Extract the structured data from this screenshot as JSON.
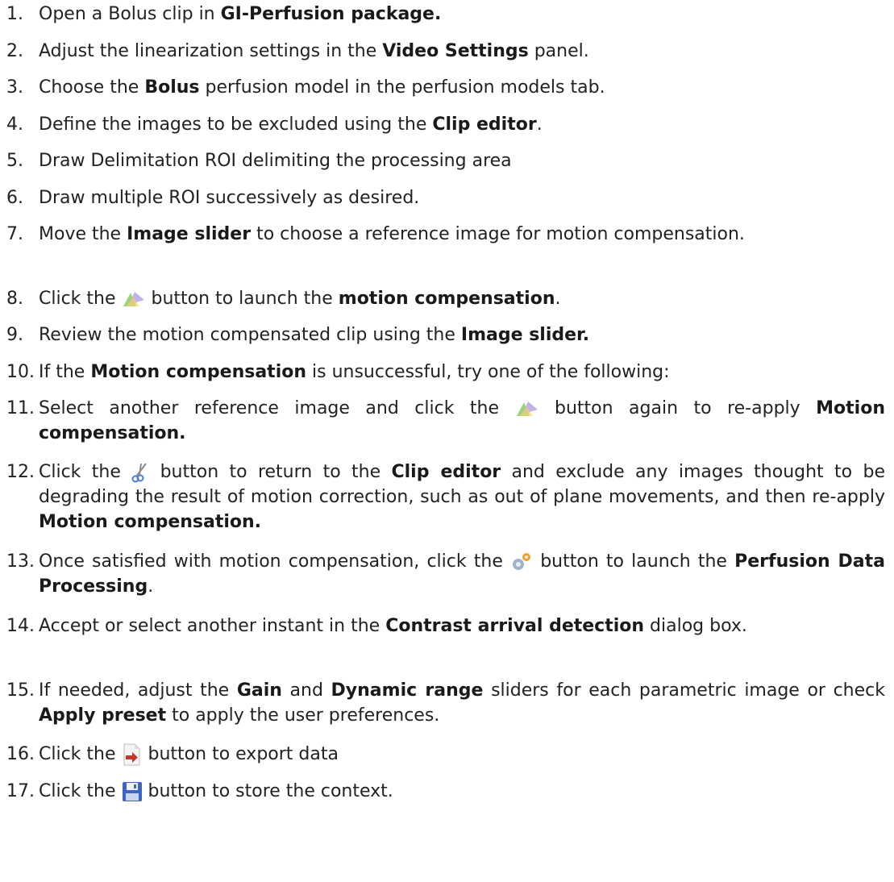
{
  "steps": [
    {
      "num": "1.",
      "parts": [
        {
          "t": "Open a Bolus clip in "
        },
        {
          "b": "GI-Perfusion package."
        }
      ]
    },
    {
      "num": "2.",
      "parts": [
        {
          "t": "Adjust the linearization settings in the "
        },
        {
          "b": "Video Settings"
        },
        {
          "t": " panel."
        }
      ]
    },
    {
      "num": "3.",
      "parts": [
        {
          "t": "Choose the "
        },
        {
          "b": "Bolus"
        },
        {
          "t": " perfusion model in the perfusion models tab."
        }
      ]
    },
    {
      "num": "4.",
      "parts": [
        {
          "t": "Define the images to be excluded using the "
        },
        {
          "b": "Clip editor"
        },
        {
          "t": "."
        }
      ]
    },
    {
      "num": "5.",
      "parts": [
        {
          "t": "Draw Delimitation ROI delimiting the processing area"
        }
      ]
    },
    {
      "num": "6.",
      "parts": [
        {
          "t": "Draw multiple ROI successively as desired."
        }
      ]
    },
    {
      "num": "7.",
      "parts": [
        {
          "t": "Move the "
        },
        {
          "b": "Image slider"
        },
        {
          "t": " to choose a reference image for motion compensation."
        }
      ]
    },
    {
      "num": "8.",
      "parts": [
        {
          "t": "Click the "
        },
        {
          "icon": "motion-compensation-icon"
        },
        {
          "t": " button to launch the "
        },
        {
          "b": "motion compensation"
        },
        {
          "t": "."
        }
      ]
    },
    {
      "num": "9.",
      "parts": [
        {
          "t": "Review the motion compensated clip using the "
        },
        {
          "b": "Image slider."
        }
      ]
    },
    {
      "num": "10.",
      "parts": [
        {
          "t": "If the "
        },
        {
          "b": "Motion compensation"
        },
        {
          "t": " is unsuccessful, try one of the following:"
        }
      ]
    },
    {
      "num": "11.",
      "parts": [
        {
          "t": "Select another reference image and click the "
        },
        {
          "icon": "motion-compensation-icon"
        },
        {
          "t": " button again to re-apply "
        },
        {
          "b": "Motion compensation."
        }
      ]
    },
    {
      "num": "12.",
      "parts": [
        {
          "t": "Click the "
        },
        {
          "icon": "scissors-icon"
        },
        {
          "t": " button to return to the "
        },
        {
          "b": "Clip editor"
        },
        {
          "t": " and exclude any images thought to be degrading the result of motion correction, such as out of plane movements, and then re-apply "
        },
        {
          "b": "Motion compensation."
        }
      ]
    },
    {
      "num": "13.",
      "parts": [
        {
          "t": "Once satisfied with motion compensation, click the "
        },
        {
          "icon": "gears-icon"
        },
        {
          "t": " button to launch the "
        },
        {
          "b": "Perfusion Data Processing"
        },
        {
          "t": "."
        }
      ]
    },
    {
      "num": "14.",
      "parts": [
        {
          "t": "Accept or select another instant in the "
        },
        {
          "b": "Contrast arrival detection"
        },
        {
          "t": " dialog box."
        }
      ]
    },
    {
      "num": "15.",
      "parts": [
        {
          "t": "If needed, adjust the "
        },
        {
          "b": "Gain"
        },
        {
          "t": " and "
        },
        {
          "b": "Dynamic range"
        },
        {
          "t": " sliders for each parametric image or check "
        },
        {
          "b": "Apply preset"
        },
        {
          "t": " to apply the user preferences."
        }
      ]
    },
    {
      "num": "16.",
      "parts": [
        {
          "t": "Click the "
        },
        {
          "icon": "export-icon"
        },
        {
          "t": " button to export data"
        }
      ]
    },
    {
      "num": "17.",
      "parts": [
        {
          "t": "Click the "
        },
        {
          "icon": "save-icon"
        },
        {
          "t": " button to store the context."
        }
      ]
    }
  ]
}
